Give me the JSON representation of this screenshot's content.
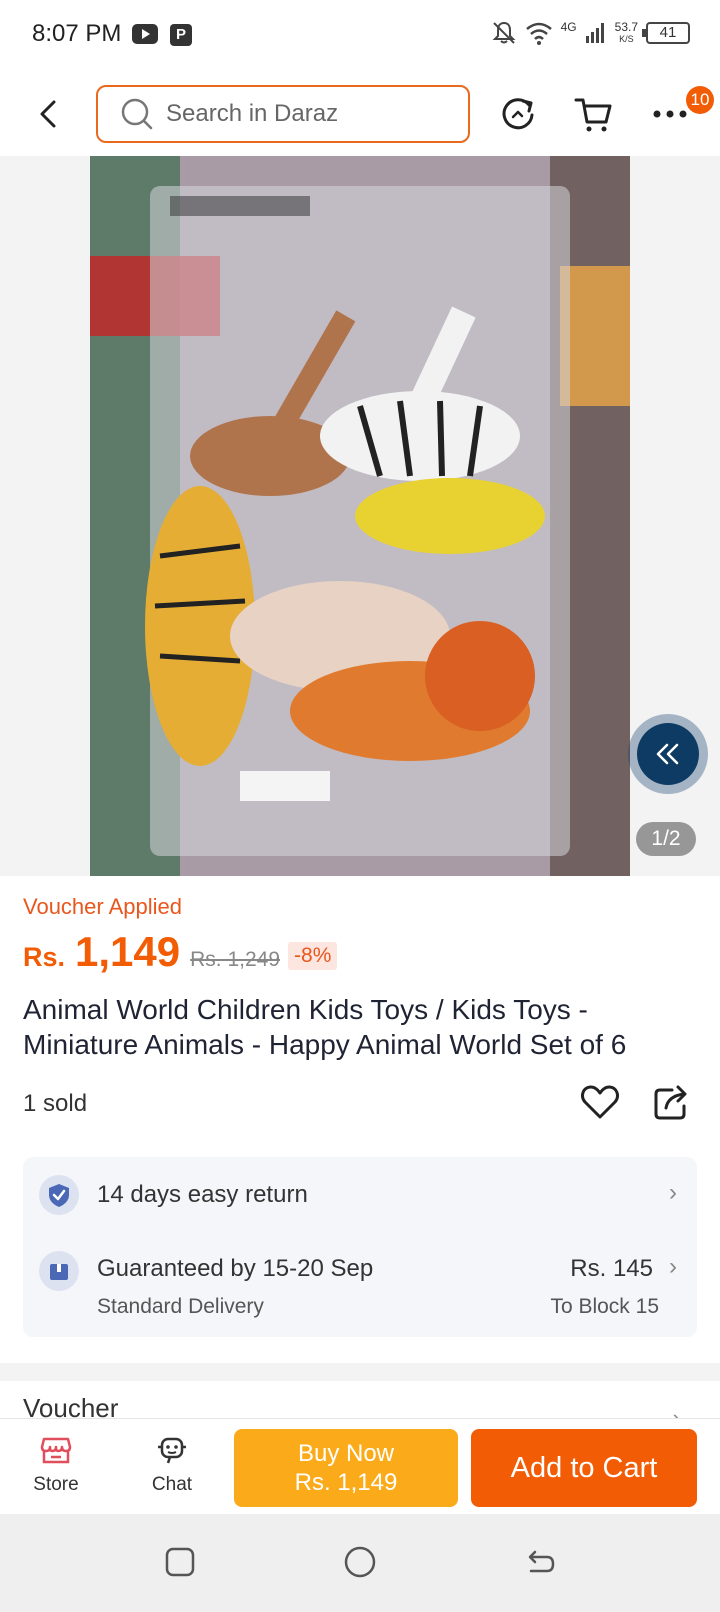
{
  "status_bar": {
    "time": "8:07 PM",
    "network_gen": "4G",
    "net_speed_value": "53.7",
    "net_speed_unit": "K/S",
    "battery": "41",
    "icons": [
      "youtube-icon",
      "p-app-icon",
      "mute-icon",
      "wifi-icon",
      "signal-icon"
    ]
  },
  "header": {
    "search_placeholder": "Search in Daraz",
    "cart_badge": "10",
    "icons": [
      "back-icon",
      "search-icon",
      "refresh-icon",
      "cart-icon",
      "more-icon"
    ]
  },
  "gallery": {
    "counter": "1/2",
    "colors": {
      "overlay_button": "#0d3b63"
    }
  },
  "product": {
    "voucher_label": "Voucher Applied",
    "currency": "Rs.",
    "price": "1,149",
    "old_price": "Rs. 1,249",
    "discount": "-8%",
    "title": "Animal World Children Kids Toys / Kids Toys - Miniature Animals - Happy Animal World Set of 6",
    "sold": "1 sold"
  },
  "delivery": {
    "return_label": "14 days easy return",
    "guarantee_label": "Guaranteed by 15-20 Sep",
    "delivery_type": "Standard Delivery",
    "delivery_fee": "Rs. 145",
    "delivery_location": "To Block 15"
  },
  "next_section": {
    "title": "Voucher"
  },
  "bottom_bar": {
    "store_label": "Store",
    "chat_label": "Chat",
    "buy_now_label": "Buy Now",
    "buy_now_price": "Rs. 1,149",
    "add_to_cart_label": "Add to Cart"
  },
  "colors": {
    "accent": "#f25c05",
    "buy_now": "#fbab1a",
    "search_border": "#e86a1f",
    "voucher_text": "#e8571d"
  }
}
